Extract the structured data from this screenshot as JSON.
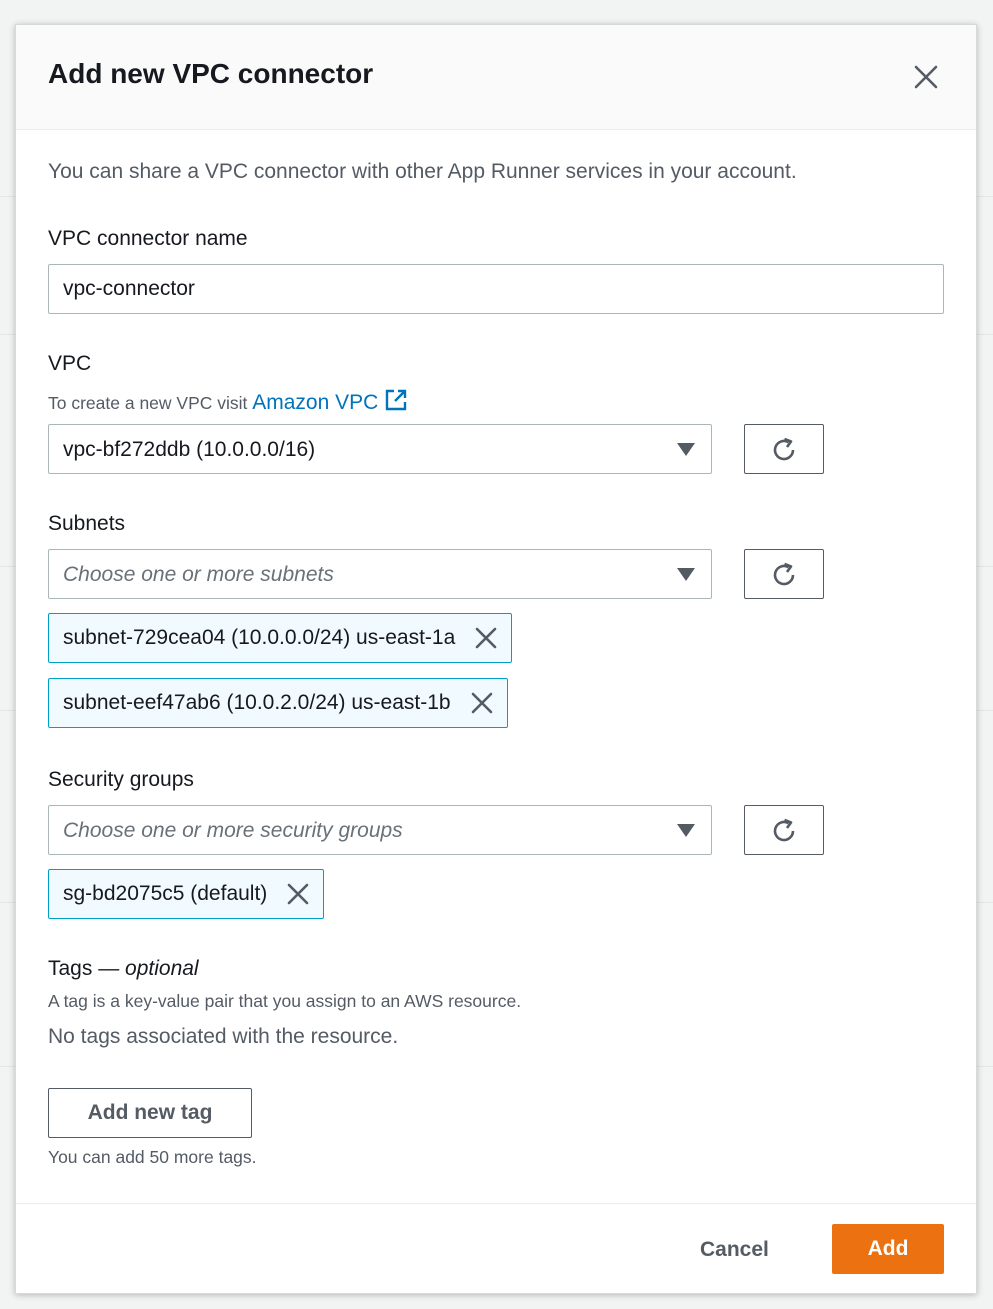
{
  "modal": {
    "title": "Add new VPC connector",
    "description": "You can share a VPC connector with other App Runner services in your account."
  },
  "connector_name": {
    "label": "VPC connector name",
    "value": "vpc-connector"
  },
  "vpc": {
    "label": "VPC",
    "hint_prefix": "To create a new VPC visit ",
    "hint_link": "Amazon VPC",
    "selected": "vpc-bf272ddb (10.0.0.0/16)"
  },
  "subnets": {
    "label": "Subnets",
    "placeholder": "Choose one or more subnets",
    "tokens": [
      "subnet-729cea04 (10.0.0.0/24) us-east-1a",
      "subnet-eef47ab6 (10.0.2.0/24) us-east-1b"
    ]
  },
  "security_groups": {
    "label": "Security groups",
    "placeholder": "Choose one or more security groups",
    "tokens": [
      "sg-bd2075c5 (default)"
    ]
  },
  "tags": {
    "label": "Tags — ",
    "label_optional": "optional",
    "hint": "A tag is a key-value pair that you assign to an AWS resource.",
    "empty": "No tags associated with the resource.",
    "add_button": "Add new tag",
    "limit_text": "You can add 50 more tags."
  },
  "footer": {
    "cancel": "Cancel",
    "add": "Add"
  },
  "colors": {
    "primary": "#ec7211",
    "link": "#0073bb",
    "token_border": "#00a1c9",
    "token_bg": "#f1faff"
  },
  "icons": {
    "close": "close-icon",
    "external_link": "external-link-icon",
    "refresh": "refresh-icon",
    "caret": "caret-down-icon",
    "remove": "remove-token-icon"
  }
}
